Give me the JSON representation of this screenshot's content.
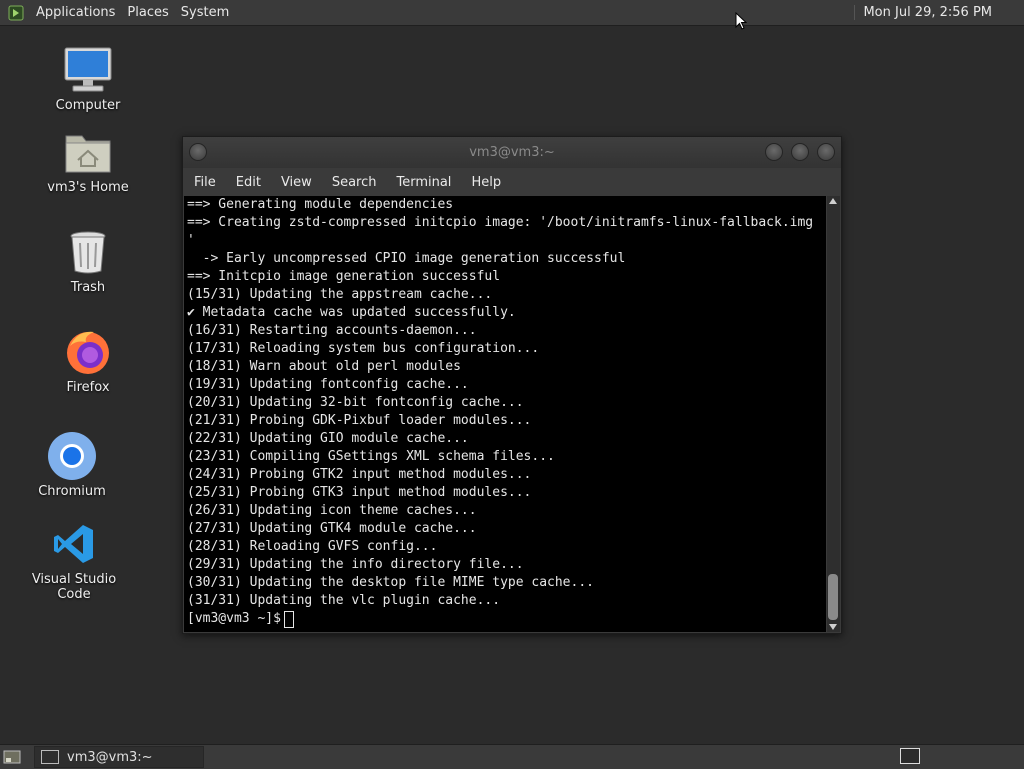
{
  "top_panel": {
    "menus": [
      "Applications",
      "Places",
      "System"
    ],
    "clock": "Mon Jul 29,  2:56 PM"
  },
  "desktop": {
    "icons": [
      {
        "label": "Computer",
        "icon": "computer-icon"
      },
      {
        "label": "vm3's Home",
        "icon": "home-folder-icon"
      },
      {
        "label": "Trash",
        "icon": "trash-icon"
      },
      {
        "label": "Firefox",
        "icon": "firefox-icon"
      },
      {
        "label": "Chromium",
        "icon": "chromium-icon"
      },
      {
        "label": "Visual Studio Code",
        "icon": "vscode-icon"
      }
    ]
  },
  "window": {
    "title": "vm3@vm3:~",
    "menu": [
      "File",
      "Edit",
      "View",
      "Search",
      "Terminal",
      "Help"
    ]
  },
  "terminal": {
    "lines": [
      "==> Generating module dependencies",
      "==> Creating zstd-compressed initcpio image: '/boot/initramfs-linux-fallback.img",
      "'",
      "  -> Early uncompressed CPIO image generation successful",
      "==> Initcpio image generation successful",
      "(15/31) Updating the appstream cache...",
      "✔ Metadata cache was updated successfully.",
      "(16/31) Restarting accounts-daemon...",
      "(17/31) Reloading system bus configuration...",
      "(18/31) Warn about old perl modules",
      "(19/31) Updating fontconfig cache...",
      "(20/31) Updating 32-bit fontconfig cache...",
      "(21/31) Probing GDK-Pixbuf loader modules...",
      "(22/31) Updating GIO module cache...",
      "(23/31) Compiling GSettings XML schema files...",
      "(24/31) Probing GTK2 input method modules...",
      "(25/31) Probing GTK3 input method modules...",
      "(26/31) Updating icon theme caches...",
      "(27/31) Updating GTK4 module cache...",
      "(28/31) Reloading GVFS config...",
      "(29/31) Updating the info directory file...",
      "(30/31) Updating the desktop file MIME type cache...",
      "(31/31) Updating the vlc plugin cache..."
    ],
    "prompt": "[vm3@vm3 ~]$"
  },
  "bottom_panel": {
    "task_label": "vm3@vm3:~"
  }
}
